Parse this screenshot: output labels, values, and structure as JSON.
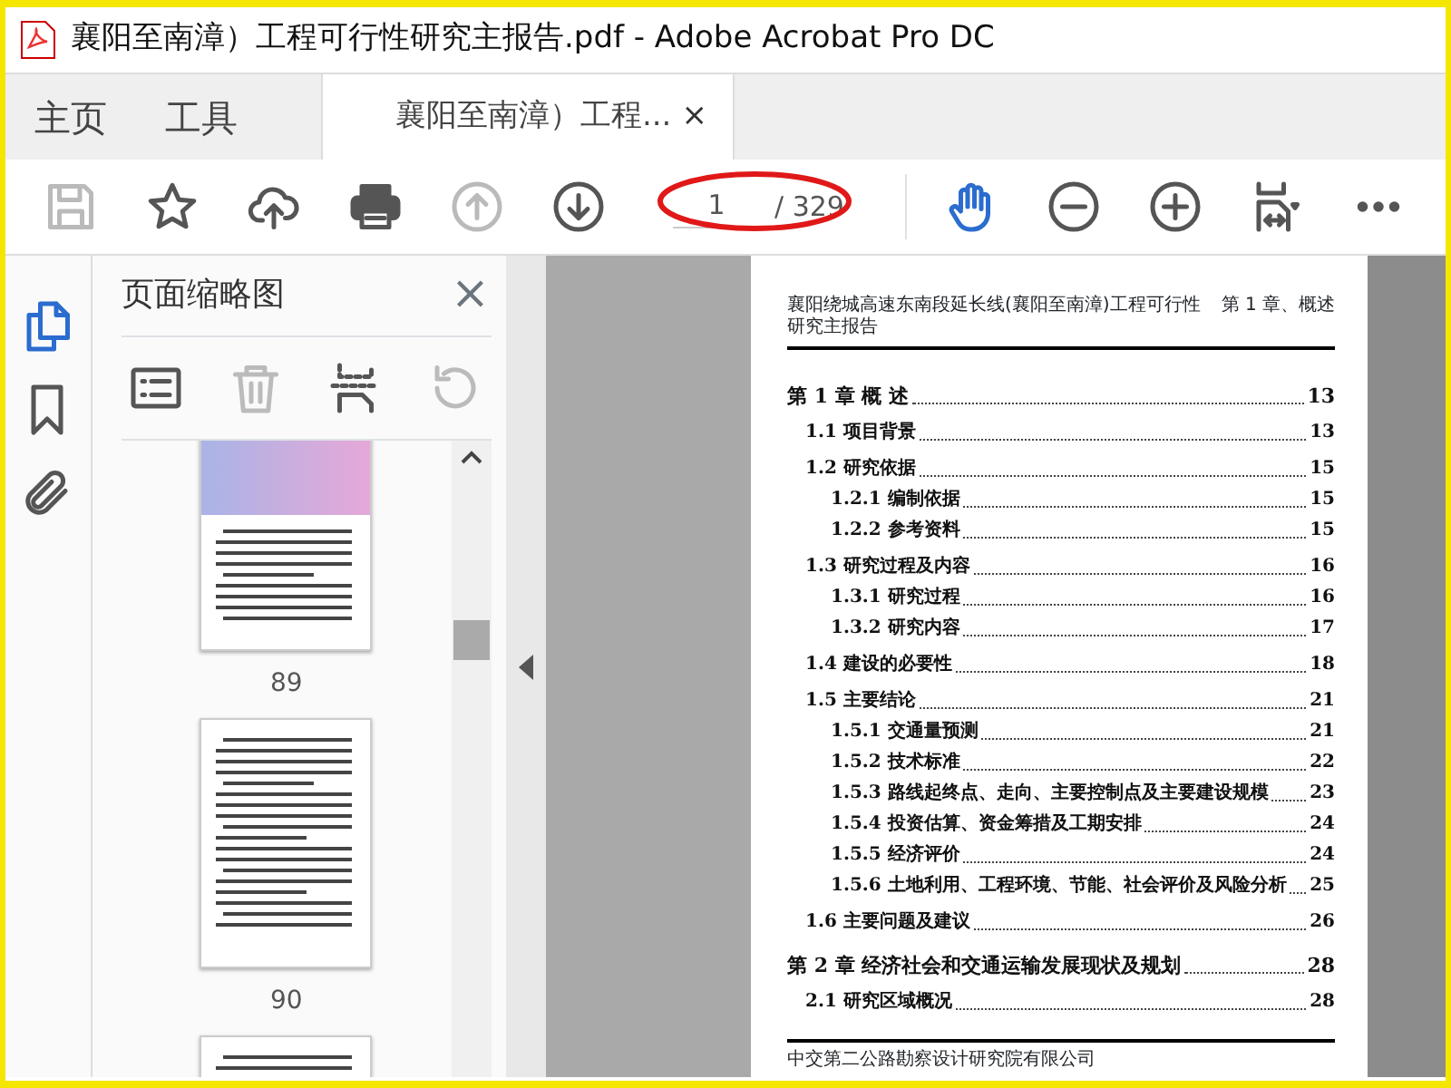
{
  "window": {
    "title": "襄阳至南漳）工程可行性研究主报告.pdf - Adobe Acrobat Pro DC"
  },
  "tabs": [
    {
      "label": "主页",
      "kind": "plain",
      "selected": false
    },
    {
      "label": "工具",
      "kind": "plain",
      "selected": false
    },
    {
      "label": "襄阳至南漳）工程...",
      "kind": "document",
      "selected": true,
      "close": "×"
    }
  ],
  "toolbar": {
    "left": [
      {
        "kind": "save",
        "disabled": true,
        "selected": false
      },
      {
        "kind": "star",
        "disabled": false,
        "selected": false
      },
      {
        "kind": "upload",
        "disabled": false,
        "selected": false
      },
      {
        "kind": "print",
        "disabled": false,
        "selected": false
      },
      {
        "kind": "prev",
        "disabled": true,
        "selected": false
      },
      {
        "kind": "next",
        "disabled": false,
        "selected": false
      }
    ],
    "page_field": {
      "value": "1",
      "total": "/ 329"
    },
    "right": [
      {
        "kind": "hand",
        "disabled": false,
        "selected": true
      },
      {
        "kind": "zoomout",
        "disabled": false,
        "selected": false
      },
      {
        "kind": "zoomin",
        "disabled": false,
        "selected": false
      },
      {
        "kind": "fit",
        "disabled": false,
        "selected": false
      },
      {
        "kind": "more",
        "disabled": false,
        "selected": false
      }
    ]
  },
  "rail": [
    {
      "kind": "pages",
      "selected": true
    },
    {
      "kind": "bookmarks",
      "selected": false
    },
    {
      "kind": "attachments",
      "selected": false
    }
  ],
  "thumbnail_panel": {
    "title": "页面缩略图",
    "close": "×",
    "tools": [
      {
        "kind": "options",
        "disabled": false
      },
      {
        "kind": "delete",
        "disabled": true
      },
      {
        "kind": "insert",
        "disabled": false
      },
      {
        "kind": "rotate",
        "disabled": true
      }
    ],
    "pages": [
      {
        "label": "89",
        "kind": "map"
      },
      {
        "label": "90",
        "kind": "text"
      },
      {
        "kind": "text"
      }
    ]
  },
  "document": {
    "header_left": "襄阳绕城高速东南段延长线(襄阳至南漳)工程可行性研究主报告",
    "header_right": "第 1 章、概述",
    "toc": [
      {
        "kind": "chapter",
        "title": "第 1 章  概  述",
        "page": "13"
      },
      {
        "kind": "section",
        "title": "1.1 项目背景",
        "page": "13"
      },
      {
        "kind": "section",
        "title": "1.2 研究依据",
        "page": "15"
      },
      {
        "kind": "subsection",
        "title": "1.2.1 编制依据",
        "page": "15"
      },
      {
        "kind": "subsection",
        "title": "1.2.2 参考资料",
        "page": "15"
      },
      {
        "kind": "section",
        "title": "1.3 研究过程及内容",
        "page": "16"
      },
      {
        "kind": "subsection",
        "title": "1.3.1 研究过程",
        "page": "16"
      },
      {
        "kind": "subsection",
        "title": "1.3.2 研究内容",
        "page": "17"
      },
      {
        "kind": "section",
        "title": "1.4 建设的必要性",
        "page": "18"
      },
      {
        "kind": "section",
        "title": "1.5 主要结论",
        "page": "21"
      },
      {
        "kind": "subsection",
        "title": "1.5.1 交通量预测",
        "page": "21"
      },
      {
        "kind": "subsection",
        "title": "1.5.2 技术标准",
        "page": "22"
      },
      {
        "kind": "subsection",
        "title": "1.5.3 路线起终点、走向、主要控制点及主要建设规模",
        "page": "23"
      },
      {
        "kind": "subsection",
        "title": "1.5.4 投资估算、资金筹措及工期安排",
        "page": "24"
      },
      {
        "kind": "subsection",
        "title": "1.5.5 经济评价",
        "page": "24"
      },
      {
        "kind": "subsection",
        "title": "1.5.6 土地利用、工程环境、节能、社会评价及风险分析",
        "page": "25"
      },
      {
        "kind": "section",
        "title": "1.6 主要问题及建议",
        "page": "26"
      },
      {
        "kind": "chapter",
        "title": "第 2 章  经济社会和交通运输发展现状及规划",
        "page": "28"
      },
      {
        "kind": "section",
        "title": "2.1 研究区域概况",
        "page": "28"
      }
    ],
    "footer": "中交第二公路勘察设计研究院有限公司"
  }
}
